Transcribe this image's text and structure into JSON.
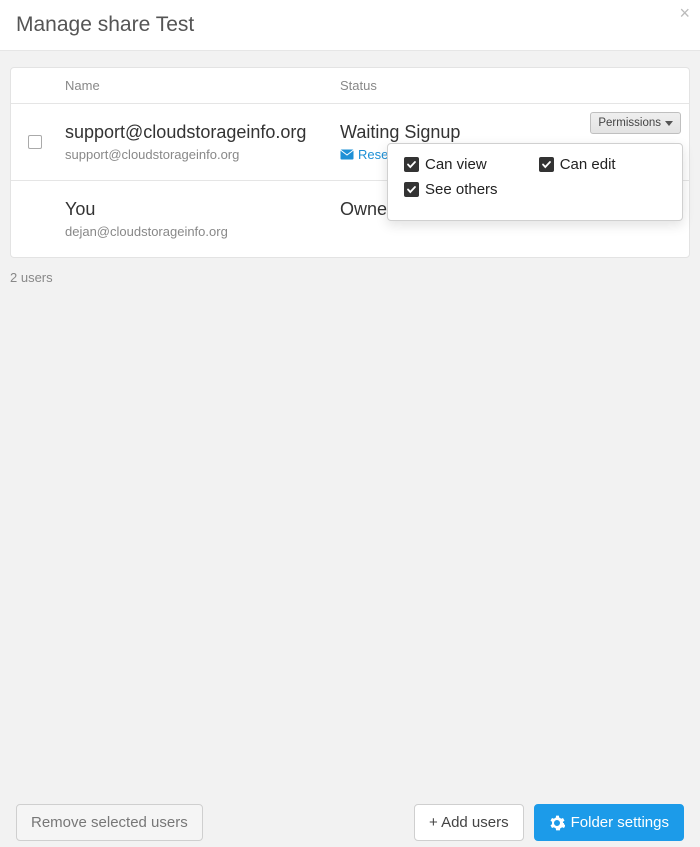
{
  "modal": {
    "title": "Manage share Test"
  },
  "table": {
    "headers": {
      "name": "Name",
      "status": "Status"
    },
    "rows": [
      {
        "name": "support@cloudstorageinfo.org",
        "email": "support@cloudstorageinfo.org",
        "status": "Waiting Signup",
        "resend_label": "Resend invitation",
        "permissions_btn": "Permissions"
      },
      {
        "name": "You",
        "email": "dejan@cloudstorageinfo.org",
        "status": "Owner"
      }
    ]
  },
  "permissions_dropdown": {
    "can_view": "Can view",
    "can_edit": "Can edit",
    "see_others": "See others"
  },
  "summary": {
    "user_count": "2 users"
  },
  "footer": {
    "remove": "Remove selected users",
    "add": "+ Add users",
    "folder_settings": "Folder settings"
  },
  "colors": {
    "accent": "#1c9be9",
    "link": "#1e90d6"
  }
}
